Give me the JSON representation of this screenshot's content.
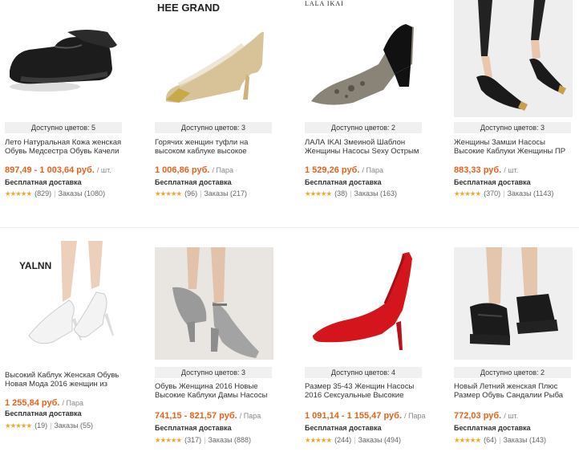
{
  "products": [
    {
      "brand": "",
      "colors": "Доступно цветов: 5",
      "title": "Лето Натуральная Кожа женская Обувь Медсестра Обувь Качели",
      "price": "897,49 - 1 003,64 руб.",
      "unit": "/ шт.",
      "shipping": "Бесплатная доставка",
      "stars": "★★★★★",
      "reviews": "(829)",
      "orders": "Заказы (1080)"
    },
    {
      "brand": "HEE GRAND",
      "colors": "Доступно цветов: 3",
      "title": "Горячих женщин туфли на высоком каблуке высокое",
      "price": "1 006,86 руб.",
      "unit": "/ Пара",
      "shipping": "Бесплатная доставка",
      "stars": "★★★★★",
      "reviews": "(96)",
      "orders": "Заказы (217)"
    },
    {
      "brand": "LALA IKAI",
      "colors": "Доступно цветов: 2",
      "title": "ЛАЛА IKAI Змеиной Шаблон Женщины Насосы Sexy Острым",
      "price": "1 529,26 руб.",
      "unit": "/ Пара",
      "shipping": "Бесплатная доставка",
      "stars": "★★★★★",
      "reviews": "(38)",
      "orders": "Заказы (163)"
    },
    {
      "brand": "",
      "colors": "Доступно цветов: 3",
      "title": "Женщины Замши Насосы Высокие Каблуки Женщины ПР",
      "price": "883,33 руб.",
      "unit": "/ шт.",
      "shipping": "Бесплатная доставка",
      "stars": "★★★★★",
      "reviews": "(370)",
      "orders": "Заказы (1143)"
    },
    {
      "brand": "YALNN",
      "colors": "",
      "title": "Высокий Каблук Женская Обувь Новая Мода 2016 женщин из",
      "price": "1 255,84 руб.",
      "unit": "/ Пара",
      "shipping": "Бесплатная доставка",
      "stars": "★★★★★",
      "reviews": "(19)",
      "orders": "Заказы (55)"
    },
    {
      "brand": "",
      "colors": "Доступно цветов: 3",
      "title": "Обувь Женщина 2016 Новые Высокие Каблуки Дамы Насосы",
      "price": "741,15 - 821,57 руб.",
      "unit": "/ Пара",
      "shipping": "Бесплатная доставка",
      "stars": "★★★★★",
      "reviews": "(317)",
      "orders": "Заказы (888)"
    },
    {
      "brand": "",
      "colors": "Доступно цветов: 4",
      "title": "Размер 35-43 Женщин Насосы 2016 Сексуальные Высокие",
      "price": "1 091,14 - 1 155,47 руб.",
      "unit": "/ Пара",
      "shipping": "Бесплатная доставка",
      "stars": "★★★★★",
      "reviews": "(244)",
      "orders": "Заказы (494)"
    },
    {
      "brand": "",
      "colors": "Доступно цветов: 2",
      "title": "Новый Летний женская Плюс Размер Обувь Сандалии Рыба",
      "price": "772,03 руб.",
      "unit": "/ шт.",
      "shipping": "Бесплатная доставка",
      "stars": "★★★★★",
      "reviews": "(64)",
      "orders": "Заказы (143)"
    }
  ],
  "colors": {
    "price": "#e8621b",
    "stars": "#f5a623",
    "colors_bg": "#f0f0f0"
  }
}
